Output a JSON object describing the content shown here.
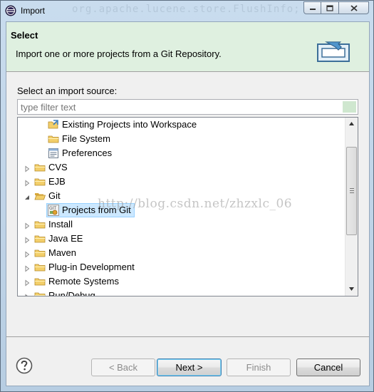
{
  "window": {
    "title": "Import",
    "ghost_title": "org.apache.lucene.store.FlushInfo;"
  },
  "banner": {
    "title": "Select",
    "description": "Import one or more projects from a Git Repository."
  },
  "source": {
    "label": "Select an import source:",
    "filter_placeholder": "type filter text"
  },
  "tree": {
    "items": [
      {
        "label": "Existing Projects into Workspace",
        "icon": "open-project-icon",
        "indent": 2,
        "arrow": "none"
      },
      {
        "label": "File System",
        "icon": "folder-icon",
        "indent": 2,
        "arrow": "none"
      },
      {
        "label": "Preferences",
        "icon": "preferences-icon",
        "indent": 2,
        "arrow": "none"
      },
      {
        "label": "CVS",
        "icon": "folder-icon",
        "indent": 1,
        "arrow": "collapsed"
      },
      {
        "label": "EJB",
        "icon": "folder-icon",
        "indent": 1,
        "arrow": "collapsed"
      },
      {
        "label": "Git",
        "icon": "folder-open-icon",
        "indent": 1,
        "arrow": "expanded"
      },
      {
        "label": "Projects from Git",
        "icon": "git-icon",
        "indent": 2,
        "arrow": "none",
        "selected": true
      },
      {
        "label": "Install",
        "icon": "folder-icon",
        "indent": 1,
        "arrow": "collapsed"
      },
      {
        "label": "Java EE",
        "icon": "folder-icon",
        "indent": 1,
        "arrow": "collapsed"
      },
      {
        "label": "Maven",
        "icon": "folder-icon",
        "indent": 1,
        "arrow": "collapsed"
      },
      {
        "label": "Plug-in Development",
        "icon": "folder-icon",
        "indent": 1,
        "arrow": "collapsed"
      },
      {
        "label": "Remote Systems",
        "icon": "folder-icon",
        "indent": 1,
        "arrow": "collapsed"
      },
      {
        "label": "Run/Debug",
        "icon": "folder-icon",
        "indent": 1,
        "arrow": "collapsed"
      }
    ],
    "watermark": "http://blog.csdn.net/zhzxlc_06"
  },
  "buttons": {
    "back": "< Back",
    "next": "Next >",
    "finish": "Finish",
    "cancel": "Cancel"
  },
  "colors": {
    "banner_bg": "#dff0e0",
    "selection": "#cce8ff",
    "folder": "#e8c263"
  }
}
